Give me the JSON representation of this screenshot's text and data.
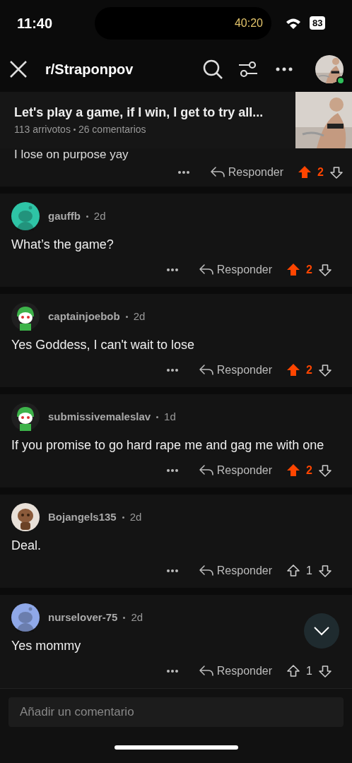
{
  "status_bar": {
    "time": "11:40",
    "timer": "40:20",
    "battery": "83"
  },
  "header": {
    "title": "r/Straponpov"
  },
  "post": {
    "title": "Let's play a game, if I win, I get to try all...",
    "upvotes": "113 arrivotos",
    "comments": "26 comentarios"
  },
  "partial_comment": {
    "text": "I lose on purpose yay",
    "reply": "Responder",
    "score": "2",
    "upvoted": true
  },
  "comments": [
    {
      "author": "gauffb",
      "age": "2d",
      "text": "What’s the game?",
      "reply": "Responder",
      "score": "2",
      "upvoted": true,
      "color": "#2ec4a6",
      "kind": "snoo"
    },
    {
      "author": "captainjoebob",
      "age": "2d",
      "text": "Yes Goddess, I can't wait to lose",
      "reply": "Responder",
      "score": "2",
      "upvoted": true,
      "color": "#1f1f1f",
      "kind": "character"
    },
    {
      "author": "submissivemaleslav",
      "age": "1d",
      "text": "If you promise to go hard rape me and gag me with one",
      "reply": "Responder",
      "score": "2",
      "upvoted": true,
      "color": "#1f1f1f",
      "kind": "character"
    },
    {
      "author": "Bojangels135",
      "age": "2d",
      "text": "Deal.",
      "reply": "Responder",
      "score": "1",
      "upvoted": false,
      "color": "#e8e0d8",
      "kind": "picture"
    },
    {
      "author": "nurselover-75",
      "age": "2d",
      "text": "Yes mommy",
      "reply": "Responder",
      "score": "1",
      "upvoted": false,
      "color": "#8fa8e8",
      "kind": "snoo"
    }
  ],
  "composer": {
    "placeholder": "Añadir un comentario"
  }
}
